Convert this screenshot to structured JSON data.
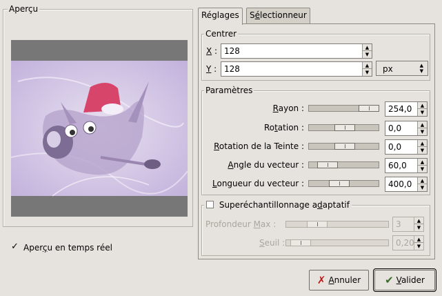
{
  "preview": {
    "legend": "Aperçu",
    "realtime_label_pre": "Aper",
    "realtime_label_u": "ç",
    "realtime_label_post": "u en temps réel",
    "realtime_checked": "✓"
  },
  "tabs": [
    {
      "label": "Réglages"
    },
    {
      "label_pre": "S",
      "label_u": "é",
      "label_post": "lectionneur"
    }
  ],
  "centrer": {
    "legend": "Centrer",
    "x_label_u": "X",
    "x_label_post": " :",
    "x_value": "128",
    "y_label_u": "Y",
    "y_label_post": " :",
    "y_value": "128",
    "unit": "px"
  },
  "parametres": {
    "legend": "Paramètres",
    "rows": [
      {
        "pre": "",
        "u": "R",
        "post": "ayon :",
        "value": "254,0",
        "fraction": 0.99
      },
      {
        "pre": "Ro",
        "u": "t",
        "post": "ation :",
        "value": "0,0",
        "fraction": 0.5
      },
      {
        "pre": "",
        "u": "R",
        "post": "otation de la Teinte :",
        "value": "0,0",
        "fraction": 0.5
      },
      {
        "pre": "",
        "u": "A",
        "post": "ngle du vecteur :",
        "value": "60,0",
        "fraction": 0.17
      },
      {
        "pre": "",
        "u": "L",
        "post": "ongueur du vecteur :",
        "value": "400,0",
        "fraction": 0.4
      }
    ]
  },
  "supersampling": {
    "label_pre": "Superéchantillonnage a",
    "label_u": "d",
    "label_post": "aptatif",
    "depth_pre": "Profondeur ",
    "depth_u": "M",
    "depth_post": "ax :",
    "depth_value": "3",
    "depth_fraction": 0.2,
    "threshold_pre": "",
    "threshold_u": "S",
    "threshold_post": "euil :",
    "threshold_value": "0,20",
    "threshold_fraction": 0.05
  },
  "buttons": {
    "cancel_pre": "",
    "cancel_u": "A",
    "cancel_post": "nnuler",
    "ok_pre": "",
    "ok_u": "V",
    "ok_post": "alider"
  },
  "colors": {
    "background": "#e6e3de",
    "preview_gray": "#777777",
    "tint": "#c8b7e0",
    "hat_red": "#d8456a"
  }
}
